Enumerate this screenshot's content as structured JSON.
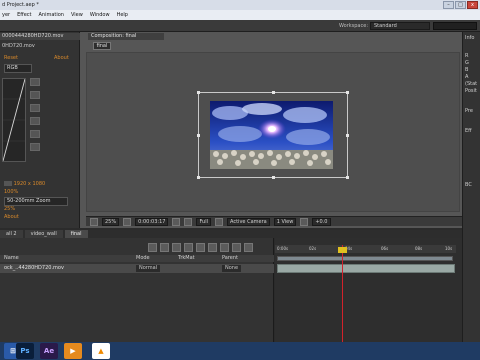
{
  "window": {
    "title": "d Project.aep *",
    "minimize": "–",
    "maximize": "□",
    "close": "x"
  },
  "menu": [
    "yer",
    "Effect",
    "Animation",
    "View",
    "Window",
    "Help"
  ],
  "workspace": {
    "label": "Workspace:",
    "value": "Standard"
  },
  "left_panel": {
    "file_name": "0000444280HD720.mov",
    "file_sub": "0HD720.mov",
    "reset_label": "Reset",
    "about_label": "About",
    "mode_value": "RGB",
    "size_value": "1920 x 1080",
    "aspect_value": "100%",
    "camera_value": "50-200mm Zoom",
    "scale_value": "25%",
    "about2": "About"
  },
  "composition": {
    "tab_label": "Composition: final",
    "chip_label": "final"
  },
  "viewer_bar": {
    "zoom": "25%",
    "timecode": "0:00:03:17",
    "resolution": "Full",
    "camera": "Active Camera",
    "views": "1 View",
    "offset": "+0.0"
  },
  "right_panel": {
    "info": "Info",
    "labels": [
      "R",
      "G",
      "B",
      "A",
      "(Stat",
      "Posit"
    ],
    "preview": "Pre",
    "effects": "Eff",
    "bc": "BC"
  },
  "timeline": {
    "tabs": [
      "all 2",
      "video_wall",
      "final"
    ],
    "columns": {
      "name": "Name",
      "mode": "Mode",
      "trkmat": "TrkMat",
      "parent": "Parent"
    },
    "layer": {
      "name": "ock_..44280HD720.mov",
      "mode": "Normal",
      "parent": "None"
    },
    "ruler_labels": [
      "0:00s",
      "02s",
      "04s",
      "06s",
      "08s",
      "10s"
    ]
  },
  "taskbar": {
    "apps": [
      {
        "name": "Ps",
        "color": "#0a1e3a",
        "fg": "#5fb0ff"
      },
      {
        "name": "Ae",
        "color": "#2a1a4a",
        "fg": "#c9a2ff"
      },
      {
        "name": "▶",
        "color": "#e58a1e",
        "fg": "#ffffff"
      },
      {
        "name": "▲",
        "color": "#ffffff",
        "fg": "#f08a00"
      }
    ]
  },
  "colors": {
    "accent_orange": "#d8892b",
    "playhead": "#d2222b",
    "layer_bar": "#9aa9a5"
  }
}
